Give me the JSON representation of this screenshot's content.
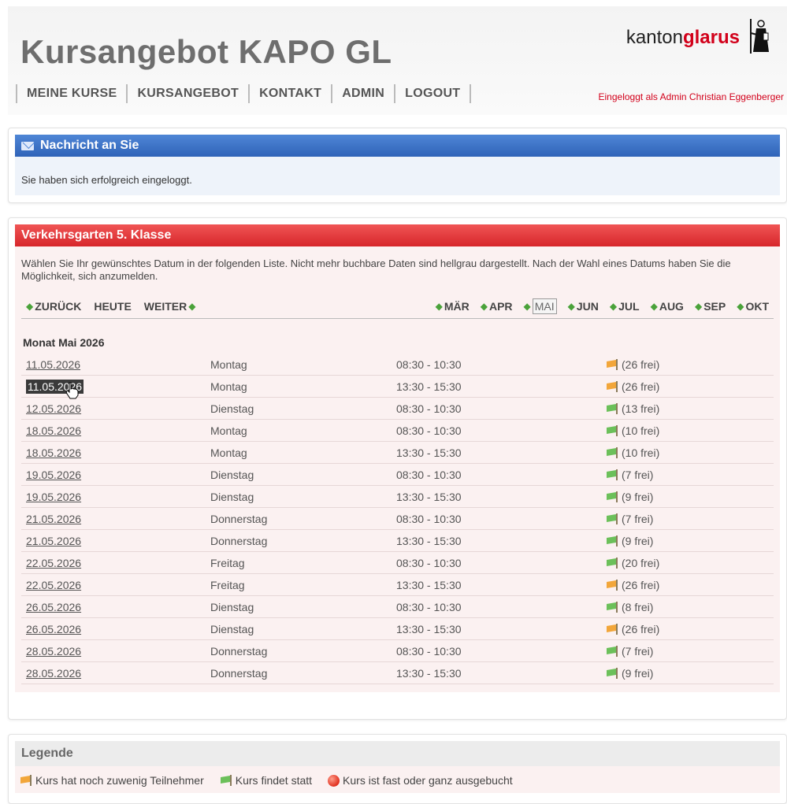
{
  "header": {
    "title": "Kursangebot KAPO GL",
    "logo_light": "kanton",
    "logo_bold": "glarus",
    "login_status": "Eingeloggt als Admin Christian Eggenberger",
    "nav": [
      "MEINE KURSE",
      "KURSANGEBOT",
      "KONTAKT",
      "ADMIN",
      "LOGOUT"
    ]
  },
  "message": {
    "title": "Nachricht an Sie",
    "text": "Sie haben sich erfolgreich eingeloggt."
  },
  "course": {
    "title": "Verkehrsgarten 5. Klasse",
    "intro": "Wählen Sie Ihr gewünschtes Datum in der folgenden Liste. Nicht mehr buchbare Daten sind hellgrau dargestellt. Nach der Wahl eines Datums haben Sie die Möglichkeit, sich anzumelden.",
    "nav_back": "ZURÜCK",
    "nav_today": "HEUTE",
    "nav_next": "WEITER",
    "months": [
      "MÄR",
      "APR",
      "MAI",
      "JUN",
      "JUL",
      "AUG",
      "SEP",
      "OKT"
    ],
    "active_month": "MAI",
    "month_title": "Monat Mai 2026",
    "rows": [
      {
        "date": "11.05.2026",
        "day": "Montag",
        "time": "08:30 - 10:30",
        "free": "(26 frei)",
        "status": "low"
      },
      {
        "date": "11.05.2026",
        "day": "Montag",
        "time": "13:30 - 15:30",
        "free": "(26 frei)",
        "status": "low"
      },
      {
        "date": "12.05.2026",
        "day": "Dienstag",
        "time": "08:30 - 10:30",
        "free": "(13 frei)",
        "status": "ok"
      },
      {
        "date": "18.05.2026",
        "day": "Montag",
        "time": "08:30 - 10:30",
        "free": "(10 frei)",
        "status": "ok"
      },
      {
        "date": "18.05.2026",
        "day": "Montag",
        "time": "13:30 - 15:30",
        "free": "(10 frei)",
        "status": "ok"
      },
      {
        "date": "19.05.2026",
        "day": "Dienstag",
        "time": "08:30 - 10:30",
        "free": "(7 frei)",
        "status": "ok"
      },
      {
        "date": "19.05.2026",
        "day": "Dienstag",
        "time": "13:30 - 15:30",
        "free": "(9 frei)",
        "status": "ok"
      },
      {
        "date": "21.05.2026",
        "day": "Donnerstag",
        "time": "08:30 - 10:30",
        "free": "(7 frei)",
        "status": "ok"
      },
      {
        "date": "21.05.2026",
        "day": "Donnerstag",
        "time": "13:30 - 15:30",
        "free": "(9 frei)",
        "status": "ok"
      },
      {
        "date": "22.05.2026",
        "day": "Freitag",
        "time": "08:30 - 10:30",
        "free": "(20 frei)",
        "status": "ok"
      },
      {
        "date": "22.05.2026",
        "day": "Freitag",
        "time": "13:30 - 15:30",
        "free": "(26 frei)",
        "status": "low"
      },
      {
        "date": "26.05.2026",
        "day": "Dienstag",
        "time": "08:30 - 10:30",
        "free": "(8 frei)",
        "status": "ok"
      },
      {
        "date": "26.05.2026",
        "day": "Dienstag",
        "time": "13:30 - 15:30",
        "free": "(26 frei)",
        "status": "low"
      },
      {
        "date": "28.05.2026",
        "day": "Donnerstag",
        "time": "08:30 - 10:30",
        "free": "(7 frei)",
        "status": "ok"
      },
      {
        "date": "28.05.2026",
        "day": "Donnerstag",
        "time": "13:30 - 15:30",
        "free": "(9 frei)",
        "status": "ok"
      }
    ]
  },
  "legend": {
    "title": "Legende",
    "items": [
      {
        "icon": "flag-orange-icon",
        "label": "Kurs hat noch zuwenig Teilnehmer"
      },
      {
        "icon": "flag-green-icon",
        "label": "Kurs findet statt"
      },
      {
        "icon": "red-dot-icon",
        "label": "Kurs ist fast oder ganz ausgebucht"
      }
    ]
  },
  "colors": {
    "brand_red": "#d2001a",
    "message_blue": "#3b6fc4",
    "course_red": "#e33a3c",
    "flag_green": "#6cc05a",
    "flag_orange": "#f2a63a"
  }
}
